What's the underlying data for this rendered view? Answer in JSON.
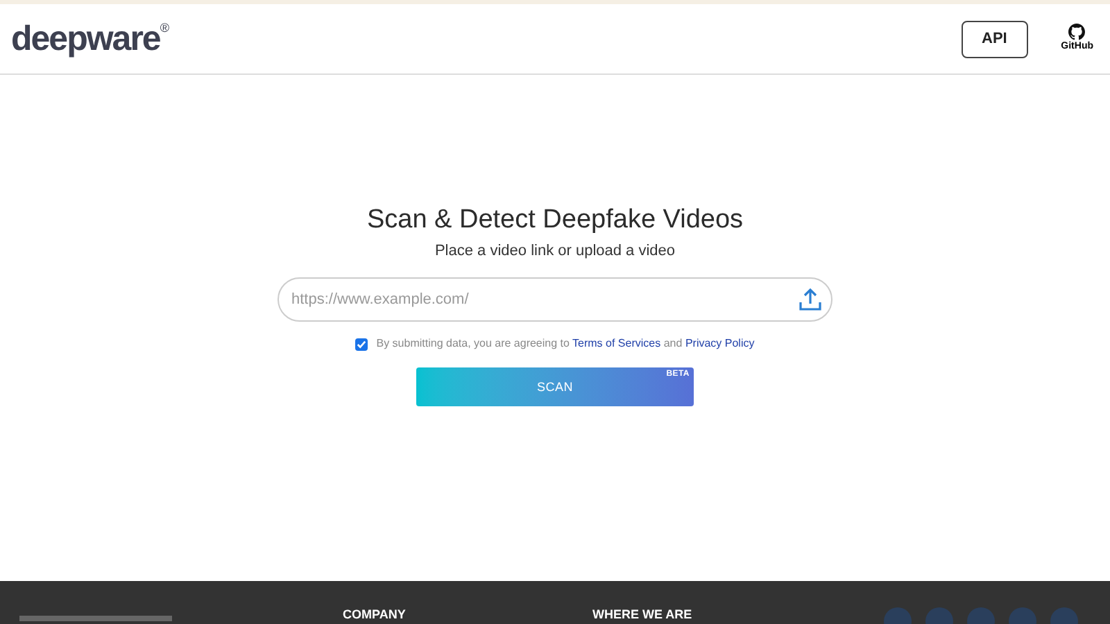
{
  "header": {
    "logo": "deepware",
    "logo_mark": "®",
    "api_button": "API",
    "github_label": "GitHub"
  },
  "hero": {
    "title": "Scan & Detect Deepfake Videos",
    "subtitle": "Place a video link or upload a video"
  },
  "url_field": {
    "placeholder": "https://www.example.com/"
  },
  "consent": {
    "checked": true,
    "text": "By submitting data, you are agreeing to",
    "terms_link": "Terms of Services",
    "joiner": "and",
    "privacy_link": "Privacy Policy"
  },
  "scan_button": {
    "label": "SCAN",
    "badge": "BETA"
  },
  "footer": {
    "headings": [
      "COMPANY",
      "WHERE WE ARE"
    ]
  }
}
